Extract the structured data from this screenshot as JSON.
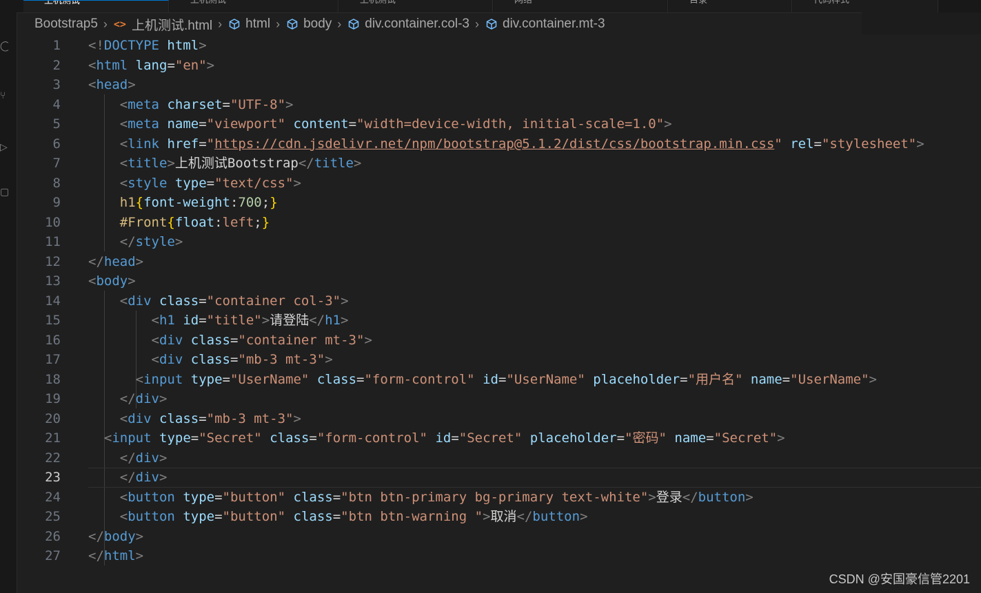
{
  "tabs": [
    {
      "label": "上机测试",
      "active": true
    },
    {
      "label": "上机测试"
    },
    {
      "label": "上机测试"
    },
    {
      "label": "网络"
    },
    {
      "label": "目录"
    },
    {
      "label": "代码样式"
    }
  ],
  "breadcrumb": {
    "root": "Bootstrap5",
    "file": "上机测试.html",
    "items": [
      "html",
      "body",
      "div.container.col-3",
      "div.container.mt-3"
    ]
  },
  "editor": {
    "current_line": 23,
    "lines": [
      {
        "n": "1"
      },
      {
        "n": "2"
      },
      {
        "n": "3"
      },
      {
        "n": "4"
      },
      {
        "n": "5"
      },
      {
        "n": "6"
      },
      {
        "n": "7"
      },
      {
        "n": "8"
      },
      {
        "n": "9"
      },
      {
        "n": "10"
      },
      {
        "n": "11"
      },
      {
        "n": "12"
      },
      {
        "n": "13"
      },
      {
        "n": "14"
      },
      {
        "n": "15"
      },
      {
        "n": "16"
      },
      {
        "n": "17"
      },
      {
        "n": "18"
      },
      {
        "n": "19"
      },
      {
        "n": "20"
      },
      {
        "n": "21"
      },
      {
        "n": "22"
      },
      {
        "n": "23"
      },
      {
        "n": "24"
      },
      {
        "n": "25"
      },
      {
        "n": "26"
      },
      {
        "n": "27"
      }
    ],
    "code": {
      "l1": "DOCTYPE",
      "l1b": "html",
      "l2a": "html",
      "l2b": "lang",
      "l2c": "\"en\"",
      "l3": "head",
      "l4a": "meta",
      "l4b": "charset",
      "l4c": "\"UTF-8\"",
      "l5a": "meta",
      "l5b": "name",
      "l5c": "\"viewport\"",
      "l5d": "content",
      "l5e": "\"width=device-width, initial-scale=1.0\"",
      "l6a": "link",
      "l6b": "href",
      "l6c": "https://cdn.jsdelivr.net/npm/bootstrap@5.1.2/dist/css/bootstrap.min.css",
      "l6d": "rel",
      "l6e": "\"stylesheet\"",
      "l7a": "title",
      "l7b": "上机测试Bootstrap",
      "l7c": "title",
      "l8a": "style",
      "l8b": "type",
      "l8c": "\"text/css\"",
      "l9a": "h1",
      "l9b": "font-weight",
      "l9c": "700",
      "l10a": "#Front",
      "l10b": "float",
      "l10c": "left",
      "l11": "style",
      "l12": "head",
      "l13": "body",
      "l14a": "div",
      "l14b": "class",
      "l14c": "\"container col-3\"",
      "l15a": "h1",
      "l15b": "id",
      "l15c": "\"title\"",
      "l15d": "请登陆",
      "l15e": "h1",
      "l16a": "div",
      "l16b": "class",
      "l16c": "\"container mt-3\"",
      "l17a": "div",
      "l17b": "class",
      "l17c": "\"mb-3 mt-3\"",
      "l18a": "input",
      "l18b": "type",
      "l18c": "\"UserName\"",
      "l18d": "class",
      "l18e": "\"form-control\"",
      "l18f": "id",
      "l18g": "\"UserName\"",
      "l18h": "placeholder",
      "l18i": "\"用户名\"",
      "l18j": "name",
      "l18k": "\"UserName\"",
      "l19": "div",
      "l20a": "div",
      "l20b": "class",
      "l20c": "\"mb-3 mt-3\"",
      "l21a": "input",
      "l21b": "type",
      "l21c": "\"Secret\"",
      "l21d": "class",
      "l21e": "\"form-control\"",
      "l21f": "id",
      "l21g": "\"Secret\"",
      "l21h": "placeholder",
      "l21i": "\"密码\"",
      "l21j": "name",
      "l21k": "\"Secret\"",
      "l22": "div",
      "l23": "div",
      "l24a": "button",
      "l24b": "type",
      "l24c": "\"button\"",
      "l24d": "class",
      "l24e": "\"btn btn-primary bg-primary text-white\"",
      "l24f": "登录",
      "l24g": "button",
      "l25a": "button",
      "l25b": "type",
      "l25c": "\"button\"",
      "l25d": "class",
      "l25e": "\"btn btn-warning \"",
      "l25f": "取消",
      "l25g": "button",
      "l26": "body",
      "l27": "html"
    }
  },
  "watermark": "CSDN @安国豪信管2201",
  "colors": {
    "tag": "#569cd6",
    "attribute": "#9cdcfe",
    "string": "#ce9178",
    "selector": "#d7ba7d",
    "number": "#b5cea8",
    "brace": "#ffd700",
    "background": "#1f1f1f"
  }
}
